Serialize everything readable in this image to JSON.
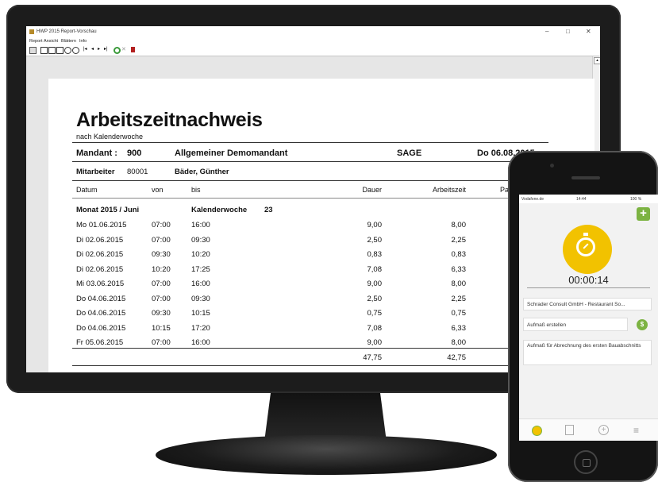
{
  "window": {
    "title": "HWP 2015 Report-Vorschau",
    "controls": {
      "minimize": "–",
      "maximize": "□",
      "close": "✕"
    }
  },
  "menu": [
    "Report",
    "Ansicht",
    "Blättern",
    "Info"
  ],
  "toolbar_icons": [
    "print-icon",
    "page-view-icon",
    "page-view-icon",
    "page-view-icon",
    "zoom-in-icon",
    "zoom-out-icon",
    "first-page-icon",
    "prev-page-icon",
    "next-page-icon",
    "last-page-icon",
    "refresh-icon",
    "close-icon",
    "exit-icon"
  ],
  "report": {
    "title": "Arbeitszeitnachweis",
    "subtitle": "nach Kalenderwoche",
    "mandant_label": "Mandant :",
    "mandant_nr": "900",
    "mandant_name": "Allgemeiner Demomandant",
    "company": "SAGE",
    "date": "Do 06.08.2015",
    "mitarbeiter_label": "Mitarbeiter",
    "mitarbeiter_nr": "80001",
    "mitarbeiter_name": "Bäder, Günther",
    "columns": {
      "datum": "Datum",
      "von": "von",
      "bis": "bis",
      "dauer": "Dauer",
      "arbeitszeit": "Arbeitszeit",
      "pause": "Pause"
    },
    "month_label": "Monat 2015 / Juni",
    "week_label": "Kalenderwoche",
    "week_nr": "23",
    "rows": [
      {
        "datum": "Mo 01.06.2015",
        "von": "07:00",
        "bis": "16:00",
        "dauer": "9,00",
        "arbeitszeit": "8,00"
      },
      {
        "datum": "Di 02.06.2015",
        "von": "07:00",
        "bis": "09:30",
        "dauer": "2,50",
        "arbeitszeit": "2,25"
      },
      {
        "datum": "Di 02.06.2015",
        "von": "09:30",
        "bis": "10:20",
        "dauer": "0,83",
        "arbeitszeit": "0,83"
      },
      {
        "datum": "Di 02.06.2015",
        "von": "10:20",
        "bis": "17:25",
        "dauer": "7,08",
        "arbeitszeit": "6,33"
      },
      {
        "datum": "Mi 03.06.2015",
        "von": "07:00",
        "bis": "16:00",
        "dauer": "9,00",
        "arbeitszeit": "8,00"
      },
      {
        "datum": "Do 04.06.2015",
        "von": "07:00",
        "bis": "09:30",
        "dauer": "2,50",
        "arbeitszeit": "2,25"
      },
      {
        "datum": "Do 04.06.2015",
        "von": "09:30",
        "bis": "10:15",
        "dauer": "0,75",
        "arbeitszeit": "0,75"
      },
      {
        "datum": "Do 04.06.2015",
        "von": "10:15",
        "bis": "17:20",
        "dauer": "7,08",
        "arbeitszeit": "6,33"
      },
      {
        "datum": "Fr 05.06.2015",
        "von": "07:00",
        "bis": "16:00",
        "dauer": "9,00",
        "arbeitszeit": "8,00"
      }
    ],
    "total_dauer": "47,75",
    "total_arbeitszeit": "42,75"
  },
  "phone": {
    "status_carrier": "Vodafone.de",
    "status_time": "14:44",
    "status_battery": "100 %",
    "timer": "00:00:14",
    "customer": "Schrader Consult GmbH - Restaurant So...",
    "action": "Aufmaß erstellen",
    "note": "Aufmaß für Abrechnung des ersten Bauabschnitts",
    "tabs": [
      "stopwatch-icon",
      "list-icon",
      "add-circle-icon",
      "menu-icon"
    ]
  },
  "colors": {
    "accent_green": "#7cb342",
    "timer_yellow": "#f2c200",
    "monitor_bezel": "#1c1c1c"
  }
}
